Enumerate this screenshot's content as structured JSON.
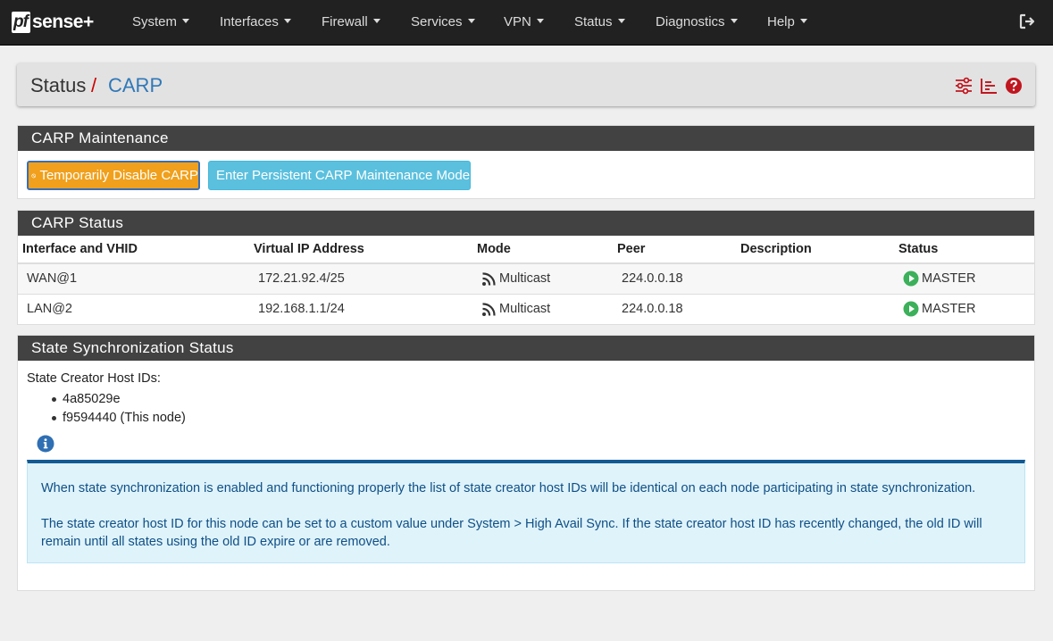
{
  "nav": {
    "brand_pf": "pf",
    "brand_rest": "sense+",
    "items": [
      {
        "label": "System"
      },
      {
        "label": "Interfaces"
      },
      {
        "label": "Firewall"
      },
      {
        "label": "Services"
      },
      {
        "label": "VPN"
      },
      {
        "label": "Status"
      },
      {
        "label": "Diagnostics"
      },
      {
        "label": "Help"
      }
    ]
  },
  "breadcrumb": {
    "section": "Status",
    "separator": "/",
    "page": "CARP"
  },
  "maintenance": {
    "title": "CARP Maintenance",
    "disable_button": "Temporarily Disable CARP",
    "persistent_button": "Enter Persistent CARP Maintenance Mode"
  },
  "carp_status": {
    "title": "CARP Status",
    "columns": [
      "Interface and VHID",
      "Virtual IP Address",
      "Mode",
      "Peer",
      "Description",
      "Status"
    ],
    "rows": [
      {
        "iface": "WAN@1",
        "vip": "172.21.92.4/25",
        "mode": "Multicast",
        "peer": "224.0.0.18",
        "description": "",
        "status": "MASTER"
      },
      {
        "iface": "LAN@2",
        "vip": "192.168.1.1/24",
        "mode": "Multicast",
        "peer": "224.0.0.18",
        "description": "",
        "status": "MASTER"
      }
    ]
  },
  "sync": {
    "title": "State Synchronization Status",
    "label": "State Creator Host IDs:",
    "ids": [
      "4a85029e",
      "f9594440 (This node)"
    ],
    "info_p1": "When state synchronization is enabled and functioning properly the list of state creator host IDs will be identical on each node participating in state synchronization.",
    "info_p2": "The state creator host ID for this node can be set to a custom value under System > High Avail Sync. If the state creator host ID has recently changed, the old ID will remain until all states using the old ID expire or are removed."
  },
  "colors": {
    "navbar": "#212121",
    "panel_header": "#424242",
    "warning_button": "#f0a01c",
    "info_button": "#5bc0de",
    "status_green": "#3cb05a",
    "breadcrumb_accent": "#3078b8",
    "icon_red": "#c0161f"
  },
  "icons": [
    "logout-icon",
    "sliders-icon",
    "chart-icon",
    "help-icon",
    "ban-icon",
    "wrench-icon",
    "rss-icon",
    "play-circle-icon",
    "info-icon"
  ]
}
